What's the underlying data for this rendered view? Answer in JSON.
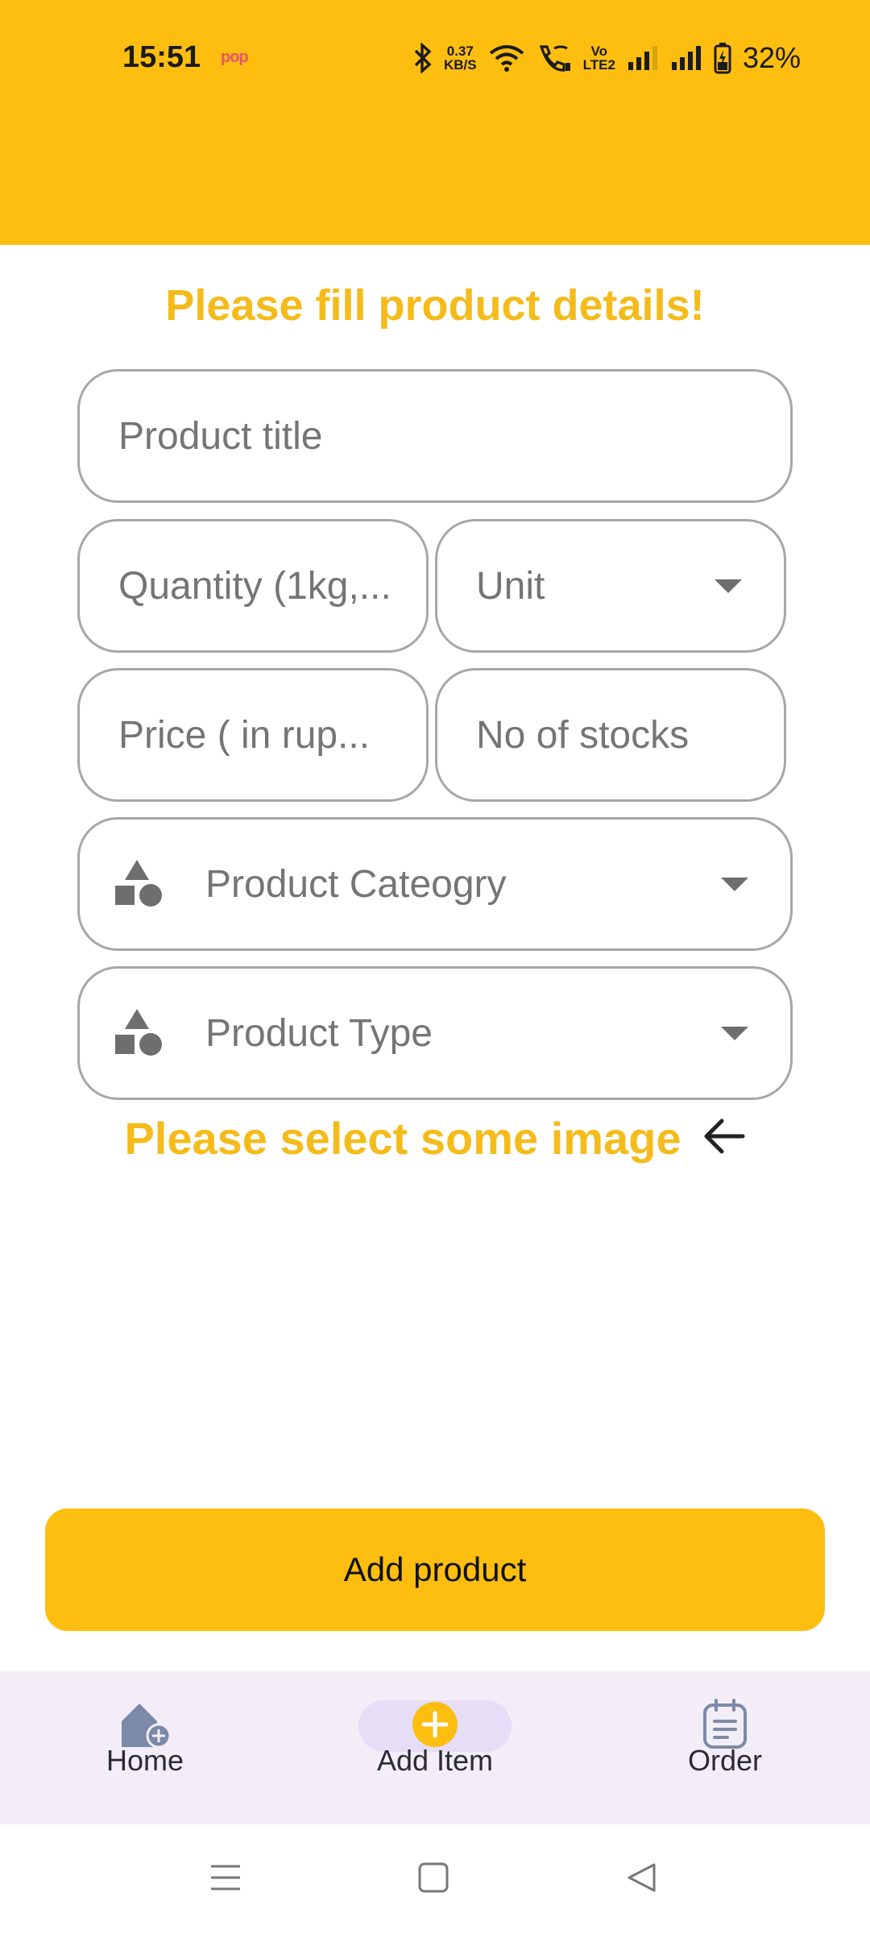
{
  "status_bar": {
    "time": "15:51",
    "carrier_badge": "pop",
    "net_speed_value": "0.37",
    "net_speed_unit": "KB/S",
    "volte_label_top": "Vo",
    "volte_label_bottom": "LTE2",
    "battery_percent": "32%"
  },
  "form": {
    "title": "Please fill product details!",
    "product_title_placeholder": "Product title",
    "quantity_placeholder": "Quantity (1kg,...",
    "unit_placeholder": "Unit",
    "price_placeholder": "Price ( in rup...",
    "stocks_placeholder": "No of stocks",
    "category_placeholder": "Product Cateogry",
    "type_placeholder": "Product Type",
    "image_prompt": "Please select some image"
  },
  "add_button_label": "Add product",
  "bottom_nav": {
    "items": [
      {
        "label": "Home",
        "icon": "home-add-icon",
        "active": false
      },
      {
        "label": "Add Item",
        "icon": "plus-circle-icon",
        "active": true
      },
      {
        "label": "Order",
        "icon": "notepad-icon",
        "active": false
      }
    ]
  },
  "colors": {
    "accent": "#FDBE10",
    "accent_text": "#F4BB1A",
    "nav_background": "#F3EDF7",
    "nav_active_pill": "#E6DDF7"
  }
}
